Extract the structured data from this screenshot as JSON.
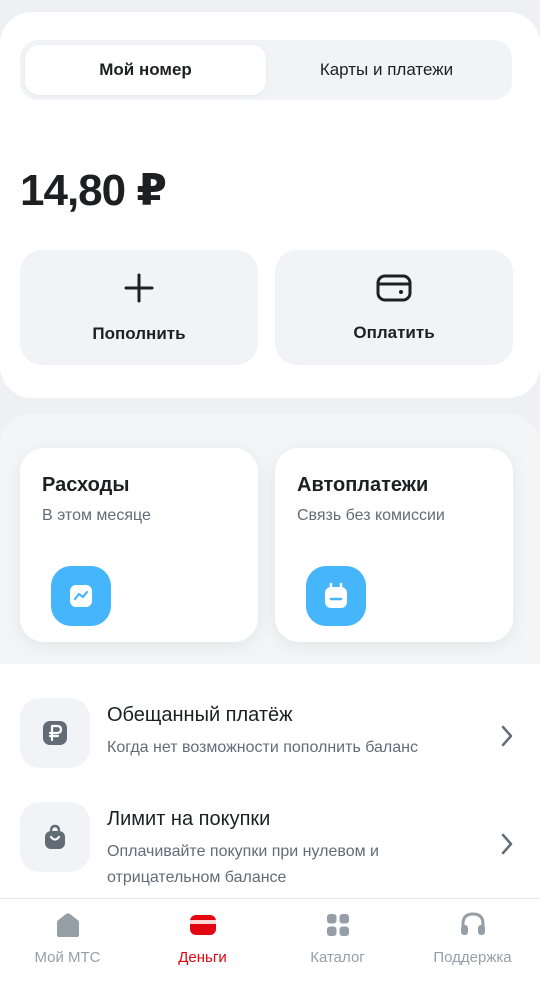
{
  "tabs": [
    {
      "label": "Мой номер",
      "active": true
    },
    {
      "label": "Карты и платежи",
      "active": false
    }
  ],
  "balance": "14,80 ₽",
  "actions": {
    "topup_label": "Пополнить",
    "pay_label": "Оплатить"
  },
  "tiles": {
    "expenses": {
      "title": "Расходы",
      "subtitle": "В этом месяце",
      "icon": "chart-icon"
    },
    "autopay": {
      "title": "Автоплатежи",
      "subtitle": "Связь без комиссии",
      "icon": "calendar-icon"
    }
  },
  "rows": {
    "promised": {
      "title": "Обещанный платёж",
      "subtitle": "Когда нет возможности пополнить баланс",
      "icon": "ruble-icon"
    },
    "limit": {
      "title": "Лимит на покупки",
      "subtitle": "Оплачивайте покупки при нулевом и отрицательном балансе",
      "icon": "shopping-bag-icon"
    }
  },
  "nav": [
    {
      "label": "Мой МТС",
      "icon": "home-icon",
      "active": false
    },
    {
      "label": "Деньги",
      "icon": "wallet-icon",
      "active": true
    },
    {
      "label": "Каталог",
      "icon": "grid-icon",
      "active": false
    },
    {
      "label": "Поддержка",
      "icon": "headset-icon",
      "active": false
    }
  ],
  "colors": {
    "accent": "#45b6fc",
    "brand_red": "#e30611",
    "text_primary": "#1d2023",
    "text_secondary": "#626c77",
    "nav_inactive": "#969fa8",
    "surface": "#f2f3f7"
  }
}
